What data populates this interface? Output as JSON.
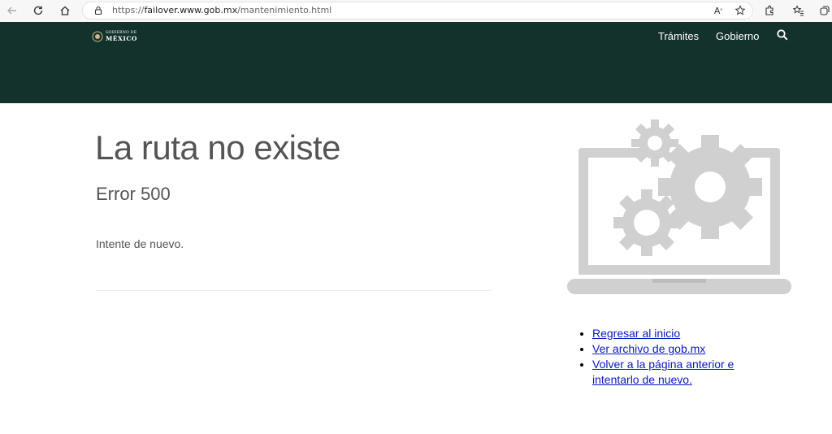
{
  "browser": {
    "url_prefix": "https://",
    "url_host": "failover.www.gob.mx",
    "url_path": "/mantenimiento.html",
    "icons": [
      "back-icon",
      "refresh-icon",
      "home-icon",
      "lock-icon",
      "read-aloud-icon",
      "favorite-icon",
      "extensions-icon",
      "favorites-icon",
      "collections-icon"
    ]
  },
  "header": {
    "logo_line1": "GOBIERNO DE",
    "logo_line2": "MÉXICO",
    "nav": [
      "Trámites",
      "Gobierno"
    ],
    "background": "#13322b"
  },
  "content": {
    "title": "La ruta no existe",
    "subtitle": "Error 500",
    "message": "Intente de nuevo."
  },
  "links": [
    "Regresar al inicio",
    "Ver archivo de gob.mx",
    "Volver a la página anterior e intentarlo de nuevo."
  ],
  "colors": {
    "text": "#545454",
    "link": "#0b18c6",
    "illustration": "#d0d0d0"
  }
}
